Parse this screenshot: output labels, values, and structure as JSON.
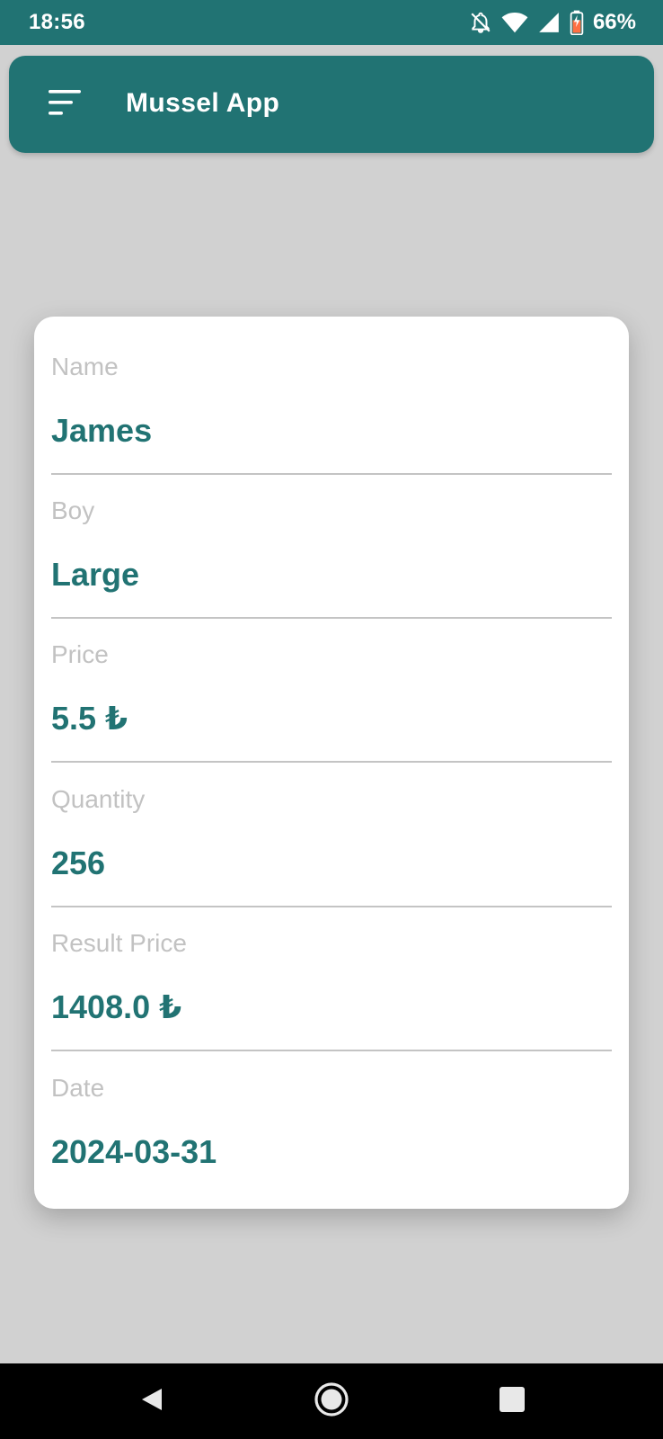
{
  "status_bar": {
    "time": "18:56",
    "battery": "66%",
    "icons": [
      "notifications-off-icon",
      "wifi-icon",
      "signal-icon",
      "battery-icon"
    ]
  },
  "app_bar": {
    "title": "Mussel App",
    "menu_icon": "menu-icon"
  },
  "record": {
    "fields": [
      {
        "label": "Name",
        "value": "James"
      },
      {
        "label": "Boy",
        "value": "Large"
      },
      {
        "label": "Price",
        "value": "5.5 ₺"
      },
      {
        "label": "Quantity",
        "value": "256"
      },
      {
        "label": "Result Price",
        "value": "1408.0 ₺"
      },
      {
        "label": "Date",
        "value": "2024-03-31"
      }
    ]
  },
  "nav_bar": {
    "icons": [
      "back-icon",
      "home-icon",
      "recents-icon"
    ]
  },
  "colors": {
    "primary": "#217373",
    "background": "#d1d1d1",
    "card": "#ffffff",
    "label": "#c2c2c2",
    "divider": "#c4c4c4",
    "battery_accent": "#ff7043"
  }
}
